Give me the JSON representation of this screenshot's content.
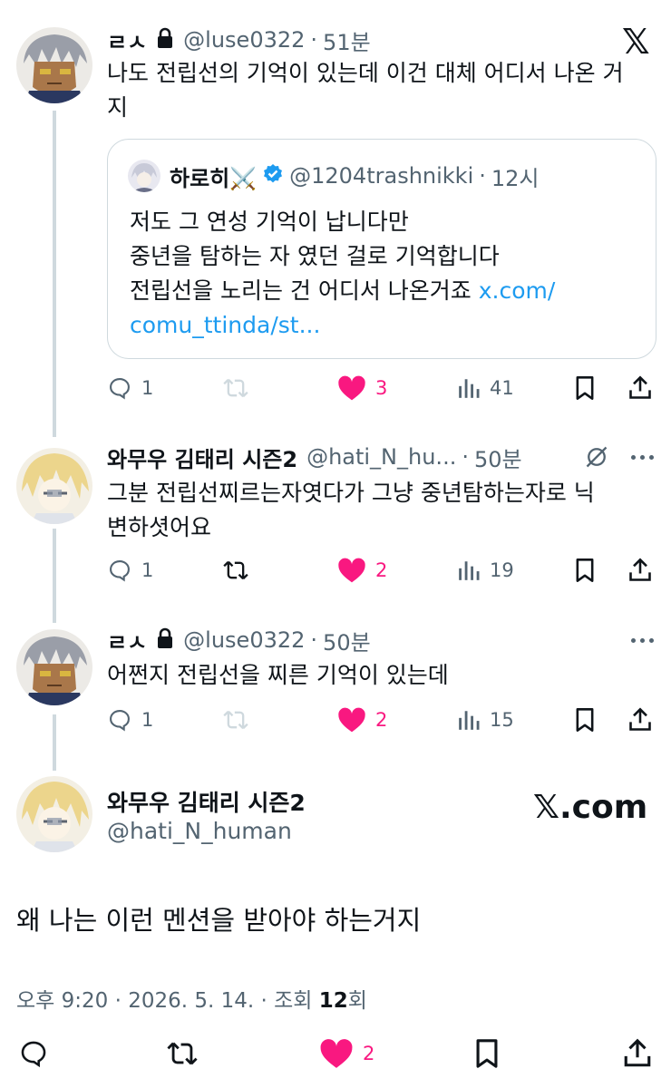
{
  "brand": {
    "x_logo": "𝕏",
    "watermark": "𝕏.com"
  },
  "tweets": [
    {
      "name": "ㄹㅅ",
      "handle": "@luse0322",
      "time": "51분",
      "text_line1": "나도 전립선의 기억이 있는데 이건 대체 어디서 나온 거",
      "text_line2": "지",
      "quote": {
        "name": "하로히⚔️",
        "handle": "@1204trashnikki",
        "time": "12시",
        "line1": "저도 그 연성 기억이 납니다만",
        "line2": "중년을 탐하는 자 였던 걸로 기억합니다",
        "line3": "전립선을 노리는 건 어디서 나온거죠",
        "link1": "x.com/",
        "link2": "comu_ttinda/st..."
      },
      "replies": "1",
      "likes": "3",
      "views": "41"
    },
    {
      "name": "와무우 김태리 시즌2",
      "handle": "@hati_N_hu...",
      "time": "50분",
      "text_line1": "그분 전립선찌르는자엿다가 그냥 중년탐하는자로 닉",
      "text_line2": "변하셧어요",
      "replies": "1",
      "likes": "2",
      "views": "19"
    },
    {
      "name": "ㄹㅅ",
      "handle": "@luse0322",
      "time": "50분",
      "text_line1": "어쩐지 전립선을 찌른 기억이 있는데",
      "replies": "1",
      "likes": "2",
      "views": "15"
    }
  ],
  "main": {
    "name": "와무우 김태리 시즌2",
    "handle": "@hati_N_human",
    "text": "왜 나는 이런 멘션을 받아야 하는거지",
    "timestamp": "오후 9:20 · 2026. 5. 14. · 조회 ",
    "views": "12",
    "views_suffix": "회",
    "likes": "2"
  },
  "colors": {
    "accent": "#1d9bf0",
    "like": "#f91880",
    "muted": "#536471",
    "text": "#0f1419",
    "border": "#cfd9de"
  }
}
